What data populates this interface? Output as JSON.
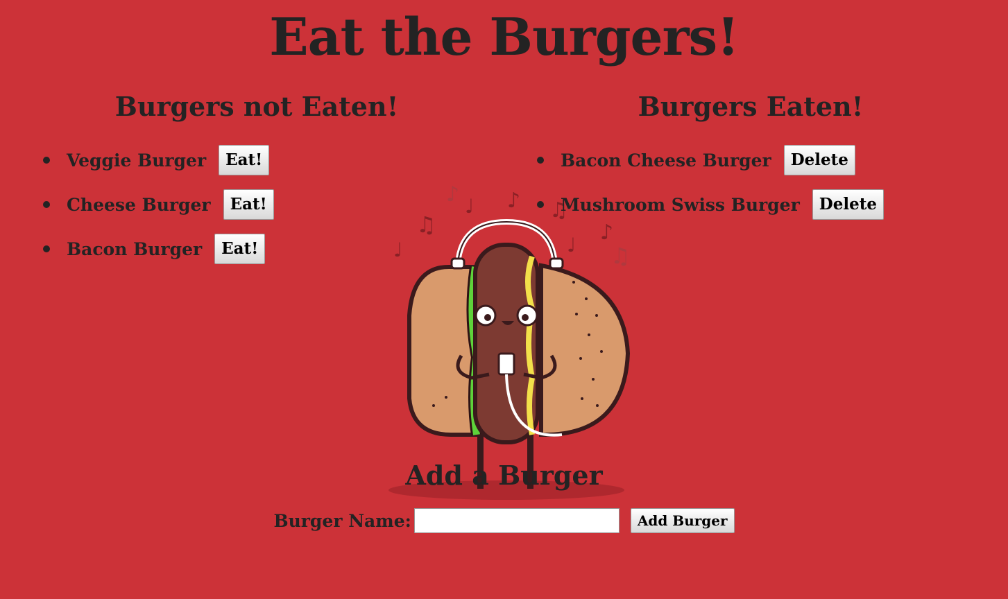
{
  "page": {
    "title": "Eat the Burgers!"
  },
  "not_eaten": {
    "heading": "Burgers not Eaten!",
    "button_label": "Eat!",
    "items": [
      {
        "name": "Veggie Burger"
      },
      {
        "name": "Cheese Burger"
      },
      {
        "name": "Bacon Burger"
      }
    ]
  },
  "eaten": {
    "heading": "Burgers Eaten!",
    "button_label": "Delete",
    "items": [
      {
        "name": "Bacon Cheese Burger"
      },
      {
        "name": "Mushroom Swiss Burger"
      }
    ]
  },
  "add_form": {
    "heading": "Add a Burger",
    "label": "Burger Name:",
    "value": "",
    "placeholder": "",
    "button_label": "Add Burger"
  },
  "colors": {
    "background": "#cc3238",
    "text": "#232323"
  },
  "decorations": {
    "mascot": "hotdog-with-headphones-illustration"
  }
}
